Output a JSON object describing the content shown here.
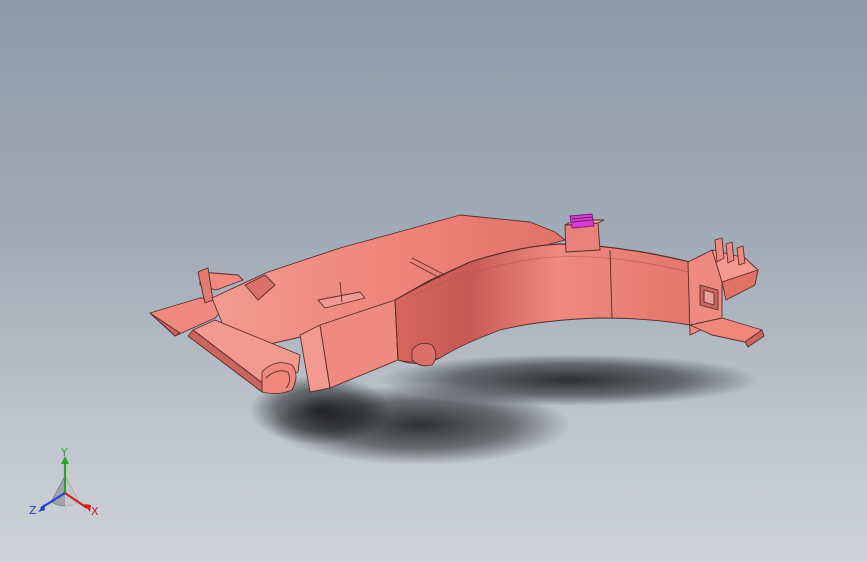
{
  "viewport": {
    "background_top": "#8d9aa8",
    "background_bottom": "#cfd3d8"
  },
  "part": {
    "body_color": "#f08a80",
    "shade_color": "#c9645e",
    "edge_color": "#5a2c2a",
    "highlight_color": "#f7a79e",
    "feature_color": "#d83fd0"
  },
  "triad": {
    "y_label": "Y",
    "x_label": "X",
    "z_label": "Z",
    "y_color": "#2ea02e",
    "x_color": "#d42020",
    "z_color": "#2040d0"
  }
}
